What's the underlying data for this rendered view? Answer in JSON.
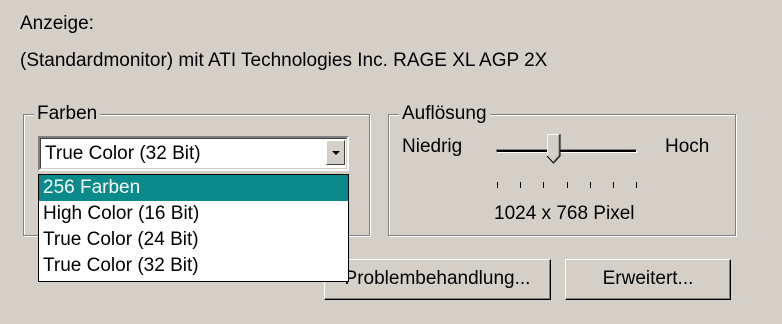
{
  "display": {
    "label": "Anzeige:",
    "adapter": "(Standardmonitor) mit ATI Technologies Inc. RAGE XL AGP 2X"
  },
  "colors": {
    "group_label": "Farben",
    "selected_value": "True Color (32 Bit)",
    "options": [
      "256 Farben",
      "High Color (16 Bit)",
      "True Color (24 Bit)",
      "True Color (32 Bit)"
    ],
    "highlighted_option": "256 Farben",
    "highlight_color": "#0a8a8a"
  },
  "resolution": {
    "group_label": "Auflösung",
    "low_label": "Niedrig",
    "high_label": "Hoch",
    "value_text": "1024 x 768 Pixel"
  },
  "buttons": {
    "troubleshoot": "Problembehandlung...",
    "advanced": "Erweitert..."
  }
}
